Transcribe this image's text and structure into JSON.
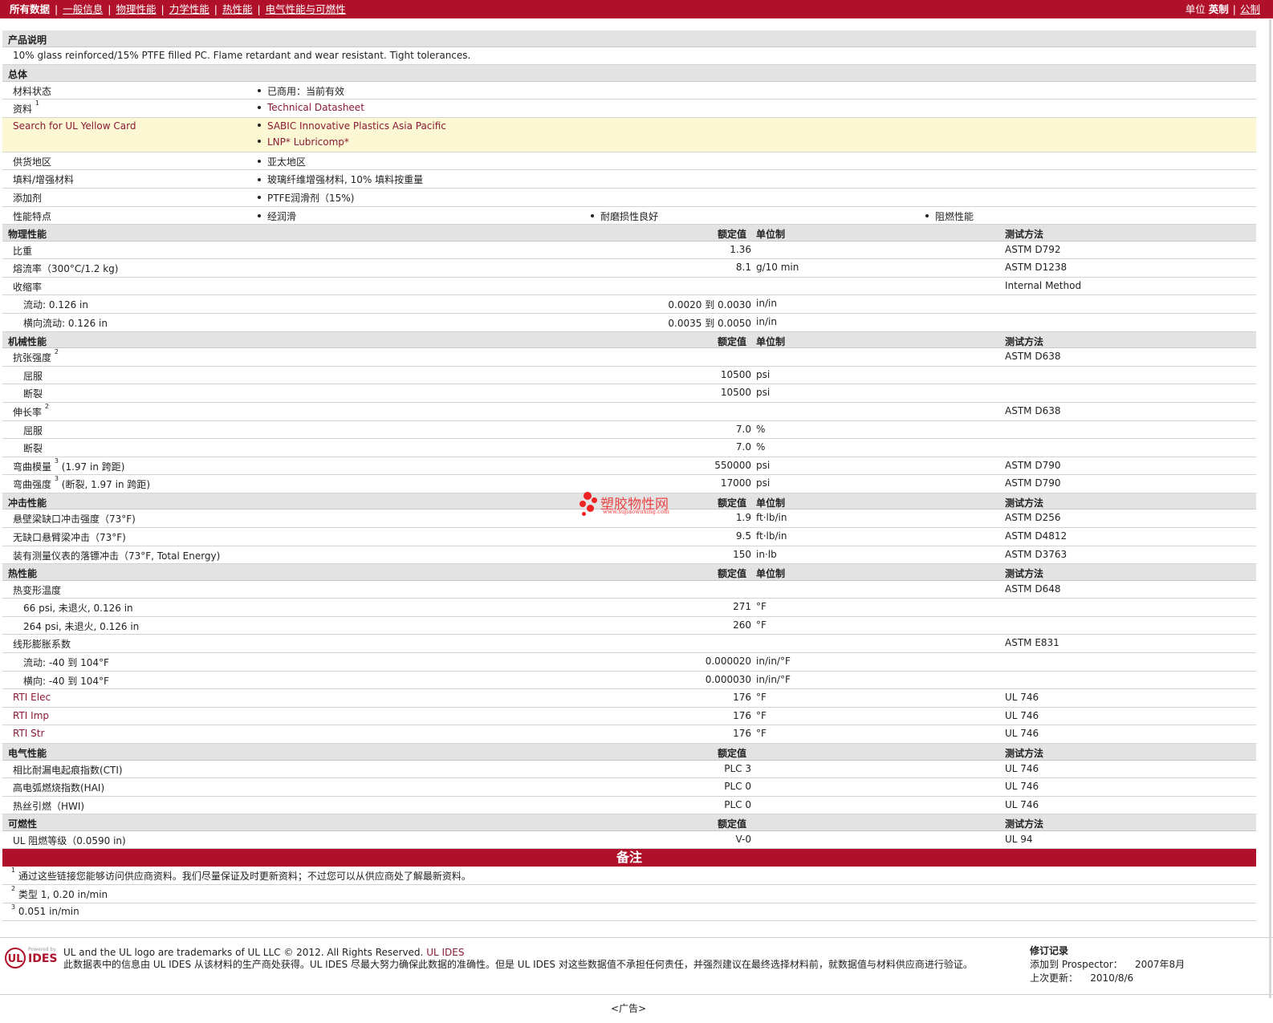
{
  "topbar": {
    "nav": [
      "所有数据",
      "一般信息",
      "物理性能",
      "力学性能",
      "热性能",
      "电气性能与可燃性"
    ],
    "units_label": "单位",
    "unit_english": "英制",
    "unit_metric": "公制"
  },
  "description": {
    "title": "产品说明",
    "text": "10% glass reinforced/15% PTFE filled PC. Flame retardant and wear resistant. Tight tolerances."
  },
  "general": {
    "title": "总体",
    "status_label": "材料状态",
    "status_value": "已商用：当前有效",
    "docs_label": "资料",
    "docs_sup": "1",
    "docs_value": "Technical Datasheet",
    "ul_label": "Search for UL Yellow Card",
    "ul_values": [
      "SABIC Innovative Plastics Asia Pacific",
      "LNP* Lubricomp*"
    ],
    "region_label": "供货地区",
    "region_value": "亚太地区",
    "filler_label": "填料/增强材料",
    "filler_value": "玻璃纤维增强材料, 10% 填料按重量",
    "additive_label": "添加剂",
    "additive_value": "PTFE润滑剂（15%)",
    "features_label": "性能特点",
    "features": [
      "经润滑",
      "耐磨损性良好",
      "阻燃性能"
    ]
  },
  "headers": {
    "nominal": "额定值",
    "unit": "单位制",
    "method": "测试方法"
  },
  "physical": {
    "title": "物理性能",
    "rows": [
      {
        "label": "比重",
        "value": "1.36",
        "unit": "",
        "method": "ASTM D792"
      },
      {
        "label": "熔流率（300°C/1.2 kg)",
        "value": "8.1",
        "unit": "g/10 min",
        "method": "ASTM D1238"
      },
      {
        "label": "收缩率",
        "value": "",
        "unit": "",
        "method": "Internal Method"
      },
      {
        "label": "流动: 0.126 in",
        "value": "0.0020 到  0.0030",
        "unit": "in/in",
        "method": ""
      },
      {
        "label": "横向流动: 0.126 in",
        "value": "0.0035 到  0.0050",
        "unit": "in/in",
        "method": ""
      }
    ]
  },
  "mechanical": {
    "title": "机械性能",
    "rows": [
      {
        "label": "抗张强度",
        "sup": "2",
        "value": "",
        "unit": "",
        "method": "ASTM D638"
      },
      {
        "label": "屈服",
        "value": "10500",
        "unit": "psi",
        "method": ""
      },
      {
        "label": "断裂",
        "value": "10500",
        "unit": "psi",
        "method": ""
      },
      {
        "label": "伸长率",
        "sup": "2",
        "value": "",
        "unit": "",
        "method": "ASTM D638"
      },
      {
        "label": "屈服",
        "value": "7.0",
        "unit": "%",
        "method": ""
      },
      {
        "label": "断裂",
        "value": "7.0",
        "unit": "%",
        "method": ""
      },
      {
        "label": "弯曲模量",
        "sup": "3",
        "suffix": "(1.97 in 跨距)",
        "value": "550000",
        "unit": "psi",
        "method": "ASTM D790"
      },
      {
        "label": "弯曲强度",
        "sup": "3",
        "suffix": "(断裂, 1.97 in 跨距)",
        "value": "17000",
        "unit": "psi",
        "method": "ASTM D790"
      }
    ]
  },
  "impact": {
    "title": "冲击性能",
    "rows": [
      {
        "label": "悬壁梁缺口冲击强度（73°F)",
        "value": "1.9",
        "unit": "ft·lb/in",
        "method": "ASTM D256"
      },
      {
        "label": "无缺口悬臂梁冲击（73°F)",
        "value": "9.5",
        "unit": "ft·lb/in",
        "method": "ASTM D4812"
      },
      {
        "label": "装有测量仪表的落镖冲击（73°F, Total Energy)",
        "value": "150",
        "unit": "in·lb",
        "method": "ASTM D3763"
      }
    ]
  },
  "thermal": {
    "title": "热性能",
    "rows": [
      {
        "label": "热变形温度",
        "value": "",
        "unit": "",
        "method": "ASTM D648"
      },
      {
        "label": "66 psi, 未退火, 0.126 in",
        "value": "271",
        "unit": "°F",
        "method": ""
      },
      {
        "label": "264 psi, 未退火, 0.126 in",
        "value": "260",
        "unit": "°F",
        "method": ""
      },
      {
        "label": "线形膨胀系数",
        "value": "",
        "unit": "",
        "method": "ASTM E831"
      },
      {
        "label": "流动: -40 到  104°F",
        "value": "0.000020",
        "unit": "in/in/°F",
        "method": ""
      },
      {
        "label": "横向: -40 到  104°F",
        "value": "0.000030",
        "unit": "in/in/°F",
        "method": ""
      },
      {
        "label": "RTI Elec",
        "value": "176",
        "unit": "°F",
        "method": "UL 746"
      },
      {
        "label": "RTI Imp",
        "value": "176",
        "unit": "°F",
        "method": "UL 746"
      },
      {
        "label": "RTI Str",
        "value": "176",
        "unit": "°F",
        "method": "UL 746"
      }
    ]
  },
  "electrical": {
    "title": "电气性能",
    "rows": [
      {
        "label": "相比耐漏电起痕指数(CTI)",
        "value": "PLC 3",
        "method": "UL 746"
      },
      {
        "label": "高电弧燃烧指数(HAI)",
        "value": "PLC 0",
        "method": "UL 746"
      },
      {
        "label": "热丝引燃（HWI)",
        "value": "PLC 0",
        "method": "UL 746"
      }
    ]
  },
  "flammability": {
    "title": "可燃性",
    "rows": [
      {
        "label": "UL 阻燃等级（0.0590 in)",
        "value": "V-0",
        "method": "UL 94"
      }
    ]
  },
  "remarks": {
    "title": "备注",
    "notes": [
      {
        "n": "1",
        "text": "通过这些链接您能够访问供应商资料。我们尽量保证及时更新资料；不过您可以从供应商处了解最新资料。"
      },
      {
        "n": "2",
        "text": "类型  1, 0.20 in/min"
      },
      {
        "n": "3",
        "text": "0.051 in/min"
      }
    ]
  },
  "watermark": {
    "name": "塑胶物性网",
    "url": "www.sujiaowuxing.com"
  },
  "footer": {
    "logo_powered": "Powered by",
    "logo_ul": "UL",
    "logo_ides": "IDES",
    "line1_prefix": "UL and the UL logo are trademarks of UL LLC © 2012. All Rights Reserved.",
    "line1_link": "UL IDES",
    "line2": "此数据表中的信息由  UL IDES 从该材料的生产商处获得。UL IDES 尽最大努力确保此数据的准确性。但是  UL IDES 对这些数据值不承担任何责任，并强烈建议在最终选择材料前，就数据值与材料供应商进行验证。",
    "rev_title": "修订记录",
    "rev_added_label": "添加到  Prospector：",
    "rev_added_value": "2007年8月",
    "rev_updated_label": "上次更新：",
    "rev_updated_value": "2010/8/6"
  },
  "ad": "<广告>"
}
